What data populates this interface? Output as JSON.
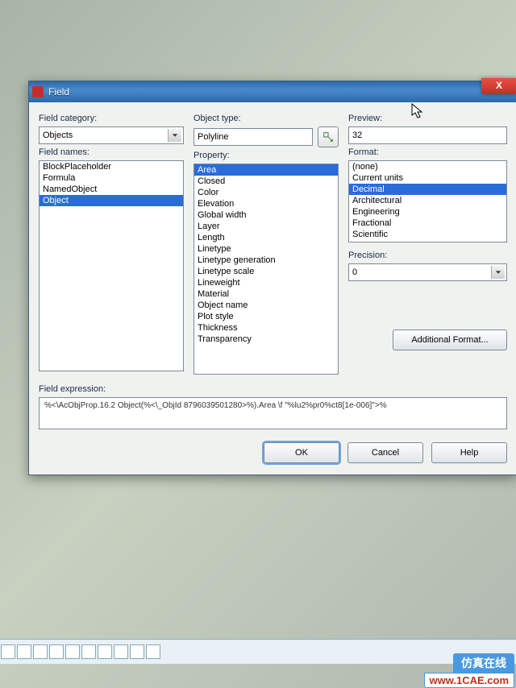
{
  "window": {
    "title": "Field",
    "close": "X"
  },
  "left": {
    "category_label": "Field category:",
    "category_value": "Objects",
    "names_label": "Field names:",
    "names": [
      "BlockPlaceholder",
      "Formula",
      "NamedObject",
      "Object"
    ],
    "names_selected": "Object"
  },
  "mid": {
    "objtype_label": "Object type:",
    "objtype_value": "Polyline",
    "property_label": "Property:",
    "properties": [
      "Area",
      "Closed",
      "Color",
      "Elevation",
      "Global width",
      "Layer",
      "Length",
      "Linetype",
      "Linetype generation",
      "Linetype scale",
      "Lineweight",
      "Material",
      "Object name",
      "Plot style",
      "Thickness",
      "Transparency"
    ],
    "properties_selected": "Area"
  },
  "right": {
    "preview_label": "Preview:",
    "preview_value": "32",
    "format_label": "Format:",
    "formats": [
      "(none)",
      "Current units",
      "Decimal",
      "Architectural",
      "Engineering",
      "Fractional",
      "Scientific"
    ],
    "formats_selected": "Decimal",
    "precision_label": "Precision:",
    "precision_value": "0",
    "additional": "Additional Format..."
  },
  "expr": {
    "label": "Field expression:",
    "value": "%<\\AcObjProp.16.2 Object(%<\\_ObjId 8796039501280>%).Area \\f \"%lu2%pr0%ct8[1e-006]\">%"
  },
  "buttons": {
    "ok": "OK",
    "cancel": "Cancel",
    "help": "Help"
  },
  "badge": {
    "cn": "仿真在线",
    "url": "www.1CAE.com"
  }
}
